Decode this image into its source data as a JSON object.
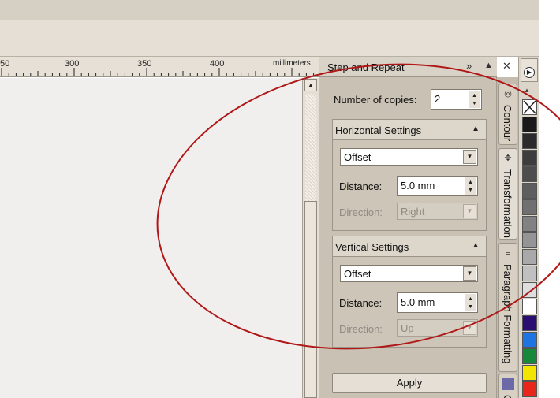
{
  "ruler": {
    "ticks": [
      "50",
      "300",
      "350",
      "400"
    ],
    "unit": "millimeters"
  },
  "docker": {
    "title": "Step and Repeat",
    "copies_label": "Number of copies:",
    "copies_value": "2",
    "horizontal": {
      "heading": "Horizontal Settings",
      "mode": "Offset",
      "distance_label": "Distance:",
      "distance_value": "5.0 mm",
      "direction_label": "Direction:",
      "direction_value": "Right"
    },
    "vertical": {
      "heading": "Vertical Settings",
      "mode": "Offset",
      "distance_label": "Distance:",
      "distance_value": "5.0 mm",
      "direction_label": "Direction:",
      "direction_value": "Up"
    },
    "apply_label": "Apply",
    "header_icons": [
      "double-chevron-right-icon",
      "triangle-up-icon",
      "close-icon"
    ]
  },
  "tabs": [
    {
      "label": "Contour",
      "icon": "contour-icon"
    },
    {
      "label": "Transformation",
      "icon": "transformation-icon"
    },
    {
      "label": "Paragraph Formatting",
      "icon": "paragraph-icon"
    },
    {
      "label": "C",
      "icon": "square-icon"
    }
  ],
  "palette": {
    "colors": [
      "#1a1a1a",
      "#2b2b2b",
      "#3d3d3d",
      "#4d4d4d",
      "#5e5e5e",
      "#707070",
      "#828282",
      "#959595",
      "#a9a9a9",
      "#c0c0c0",
      "#dedede",
      "#ffffff",
      "#2a0e72",
      "#1e74e0",
      "#16883a",
      "#f2e600",
      "#e8261a",
      "#e0257c"
    ]
  },
  "annotation": {
    "color": "#b01818"
  }
}
